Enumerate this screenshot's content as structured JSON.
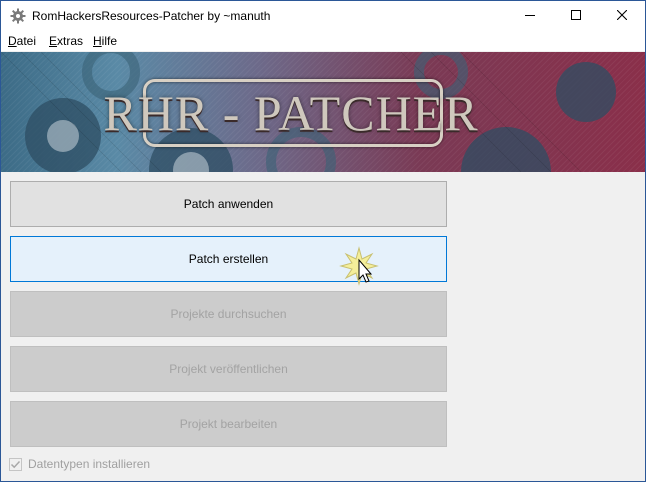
{
  "window": {
    "title": "RomHackersResources-Patcher by ~manuth",
    "controls": {
      "minimize": "minimize-icon",
      "maximize": "maximize-icon",
      "close": "close-icon"
    }
  },
  "menu": {
    "items": [
      {
        "accel": "D",
        "rest": "atei"
      },
      {
        "accel": "E",
        "rest": "xtras"
      },
      {
        "accel": "H",
        "rest": "ilfe"
      }
    ]
  },
  "banner": {
    "title": "RHR - PATCHER"
  },
  "buttons": [
    {
      "label": "Patch anwenden",
      "state": "normal"
    },
    {
      "label": "Patch erstellen",
      "state": "hover"
    },
    {
      "label": "Projekte durchsuchen",
      "state": "disabled"
    },
    {
      "label": "Projekt veröffentlichen",
      "state": "disabled"
    },
    {
      "label": "Projekt bearbeiten",
      "state": "disabled"
    }
  ],
  "checkbox": {
    "label": "Datentypen installieren",
    "checked": true,
    "enabled": false
  },
  "colors": {
    "accent": "#0078d7",
    "banner_left": "#3c6b86",
    "banner_right": "#8a2f4a"
  }
}
